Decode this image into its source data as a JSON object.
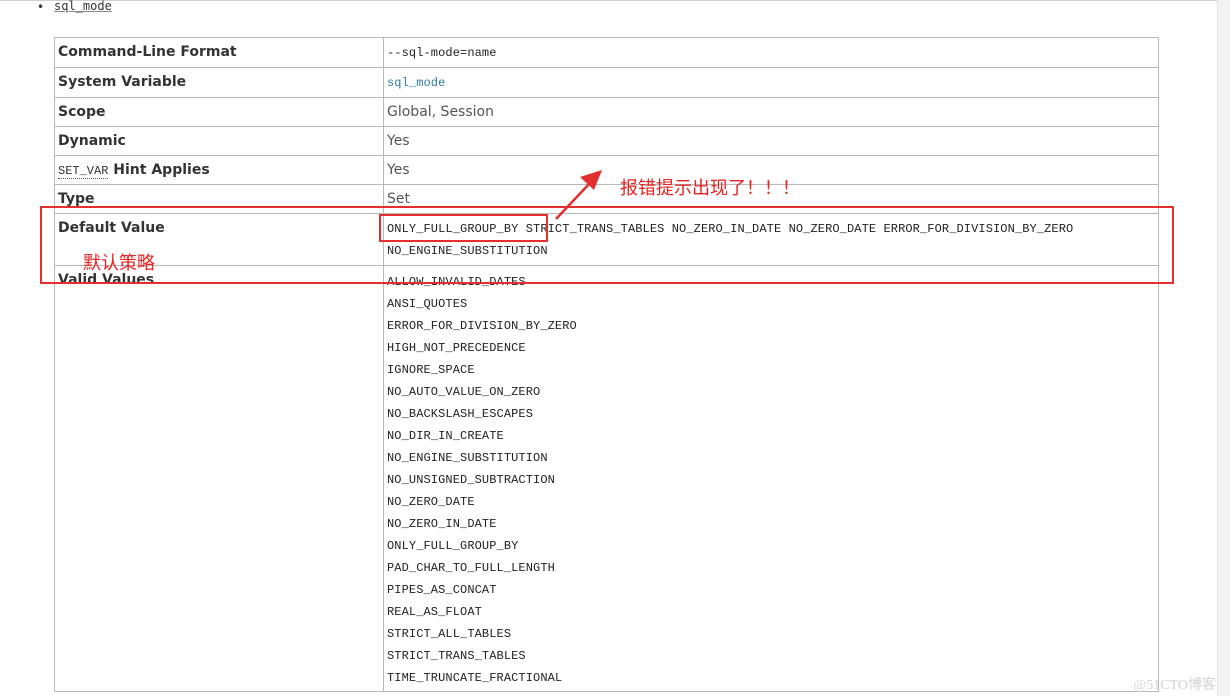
{
  "header": {
    "bullet": "•",
    "link": "sql_mode"
  },
  "rows": {
    "cmdline": {
      "label": "Command-Line Format",
      "value": "--sql-mode=name"
    },
    "sysvar": {
      "label": "System Variable",
      "value": "sql_mode"
    },
    "scope": {
      "label": "Scope",
      "value": "Global, Session"
    },
    "dynamic": {
      "label": "Dynamic",
      "value": "Yes"
    },
    "setvar": {
      "label_code": "SET_VAR",
      "label_rest": " Hint Applies",
      "value": "Yes"
    },
    "type": {
      "label": "Type",
      "value": "Set"
    },
    "default": {
      "label": "Default Value",
      "line1": "ONLY_FULL_GROUP_BY STRICT_TRANS_TABLES NO_ZERO_IN_DATE NO_ZERO_DATE ERROR_FOR_DIVISION_BY_ZERO",
      "line2": "NO_ENGINE_SUBSTITUTION"
    },
    "valid": {
      "label": "Valid Values",
      "values": [
        "ALLOW_INVALID_DATES",
        "ANSI_QUOTES",
        "ERROR_FOR_DIVISION_BY_ZERO",
        "HIGH_NOT_PRECEDENCE",
        "IGNORE_SPACE",
        "NO_AUTO_VALUE_ON_ZERO",
        "NO_BACKSLASH_ESCAPES",
        "NO_DIR_IN_CREATE",
        "NO_ENGINE_SUBSTITUTION",
        "NO_UNSIGNED_SUBTRACTION",
        "NO_ZERO_DATE",
        "NO_ZERO_IN_DATE",
        "ONLY_FULL_GROUP_BY",
        "PAD_CHAR_TO_FULL_LENGTH",
        "PIPES_AS_CONCAT",
        "REAL_AS_FLOAT",
        "STRICT_ALL_TABLES",
        "STRICT_TRANS_TABLES",
        "TIME_TRUNCATE_FRACTIONAL"
      ]
    }
  },
  "annotations": {
    "error_note": "报错提示出现了！！！",
    "default_note": "默认策略",
    "color": "#e62222"
  },
  "watermark": "@51CTO博客"
}
